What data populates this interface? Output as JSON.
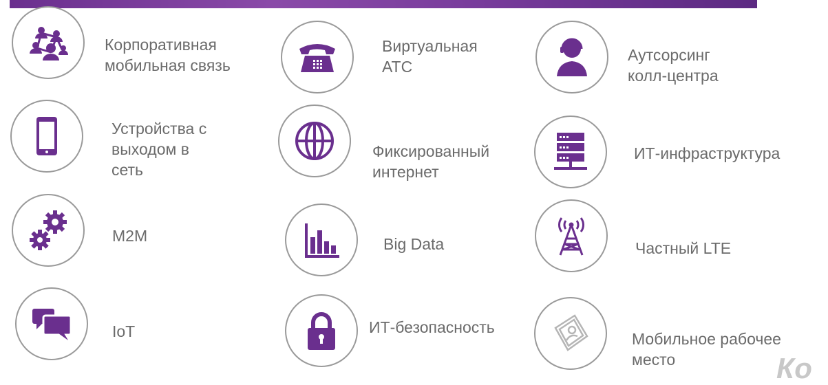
{
  "header": {
    "accent_color": "#6a2f8e"
  },
  "tiles": [
    {
      "label": "Корпоративная\nмобильная связь",
      "icon": "people-network-icon"
    },
    {
      "label": "Виртуальная\nАТС",
      "icon": "telephone-icon"
    },
    {
      "label": "Аутсорсинг\nколл-центра",
      "icon": "operator-headset-icon"
    },
    {
      "label": "Устройства с\nвыходом в\nсеть",
      "icon": "smartphone-icon"
    },
    {
      "label": "Фиксированный\nинтернет",
      "icon": "globe-icon"
    },
    {
      "label": "ИТ-инфраструктура",
      "icon": "server-icon"
    },
    {
      "label": "M2M",
      "icon": "gears-icon"
    },
    {
      "label": "Big Data",
      "icon": "bar-chart-icon"
    },
    {
      "label": "Частный LTE",
      "icon": "antenna-tower-icon"
    },
    {
      "label": "IoT",
      "icon": "chat-bubbles-icon"
    },
    {
      "label": "ИТ-безопасность",
      "icon": "padlock-icon"
    },
    {
      "label": "Мобильное рабочее\nместо",
      "icon": "mobile-workplace-icon"
    }
  ],
  "brand_text": "Ко",
  "colors": {
    "icon": "#6a2f8e",
    "ring": "#9a9a9a",
    "text": "#6b6b6b"
  }
}
